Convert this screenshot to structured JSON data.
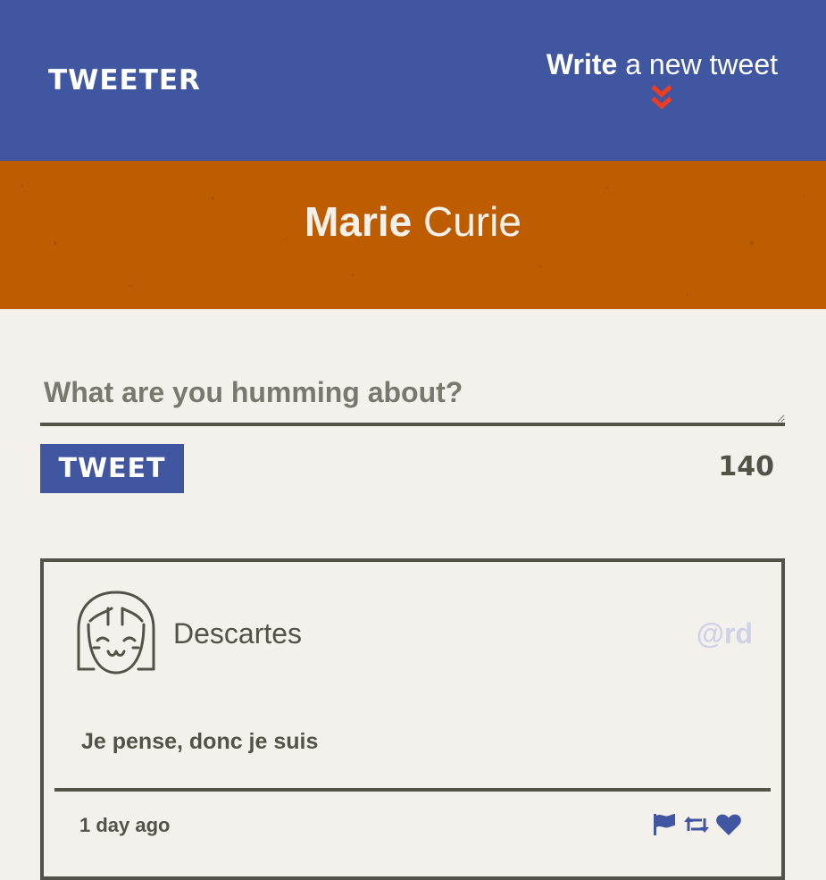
{
  "nav": {
    "brand": "Tweeter",
    "compose_bold": "Write",
    "compose_rest": " a new tweet",
    "chevron_icon": "double-chevron-down-icon"
  },
  "profile": {
    "first_name": "Marie",
    "last_name": " Curie"
  },
  "compose": {
    "placeholder": "What are you humming about?",
    "value": "",
    "button_label": "Tweet",
    "counter": "140"
  },
  "tweets": [
    {
      "name": "Descartes",
      "handle": "@rd",
      "content": "Je pense, donc je suis",
      "time": "1 day ago",
      "actions": [
        "flag-icon",
        "retweet-icon",
        "heart-icon"
      ]
    }
  ],
  "colors": {
    "nav": "#4056a1",
    "banner": "#bd5c00",
    "background": "#f4f1ec",
    "text": "#545149",
    "accent": "#f13c20",
    "handle": "#cfd1e6"
  }
}
